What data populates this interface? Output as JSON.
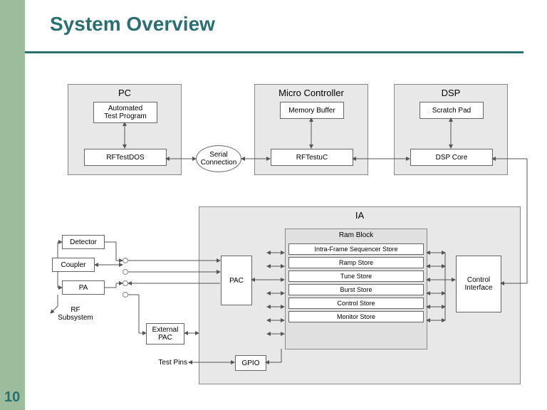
{
  "title": "System Overview",
  "pageNumber": "10",
  "blocks": {
    "pc": {
      "title": "PC",
      "items": {
        "testProgram": "Automated\nTest Program",
        "rftestdos": "RFTestDOS"
      }
    },
    "micro": {
      "title": "Micro Controller",
      "items": {
        "memBuffer": "Memory Buffer",
        "rftestuc": "RFTestuC"
      }
    },
    "dsp": {
      "title": "DSP",
      "items": {
        "scratch": "Scratch Pad",
        "core": "DSP Core"
      }
    },
    "ia": {
      "title": "IA",
      "pac": "PAC",
      "gpio": "GPIO",
      "ctrlIf": "Control\nInterface",
      "ramBlock": {
        "title": "Ram Block",
        "items": {
          "ifs": "Intra-Frame Sequencer Store",
          "ramp": "Ramp Store",
          "tune": "Tune Store",
          "burst": "Burst Store",
          "ctrl": "Control Store",
          "mon": "Monitor Store"
        }
      }
    }
  },
  "serial": "Serial\nConnection",
  "external": {
    "detector": "Detector",
    "coupler": "Coupler",
    "pa": "PA",
    "extPac": "External\nPAC",
    "rfSub": "RF\nSubsystem",
    "testPins": "Test Pins"
  }
}
